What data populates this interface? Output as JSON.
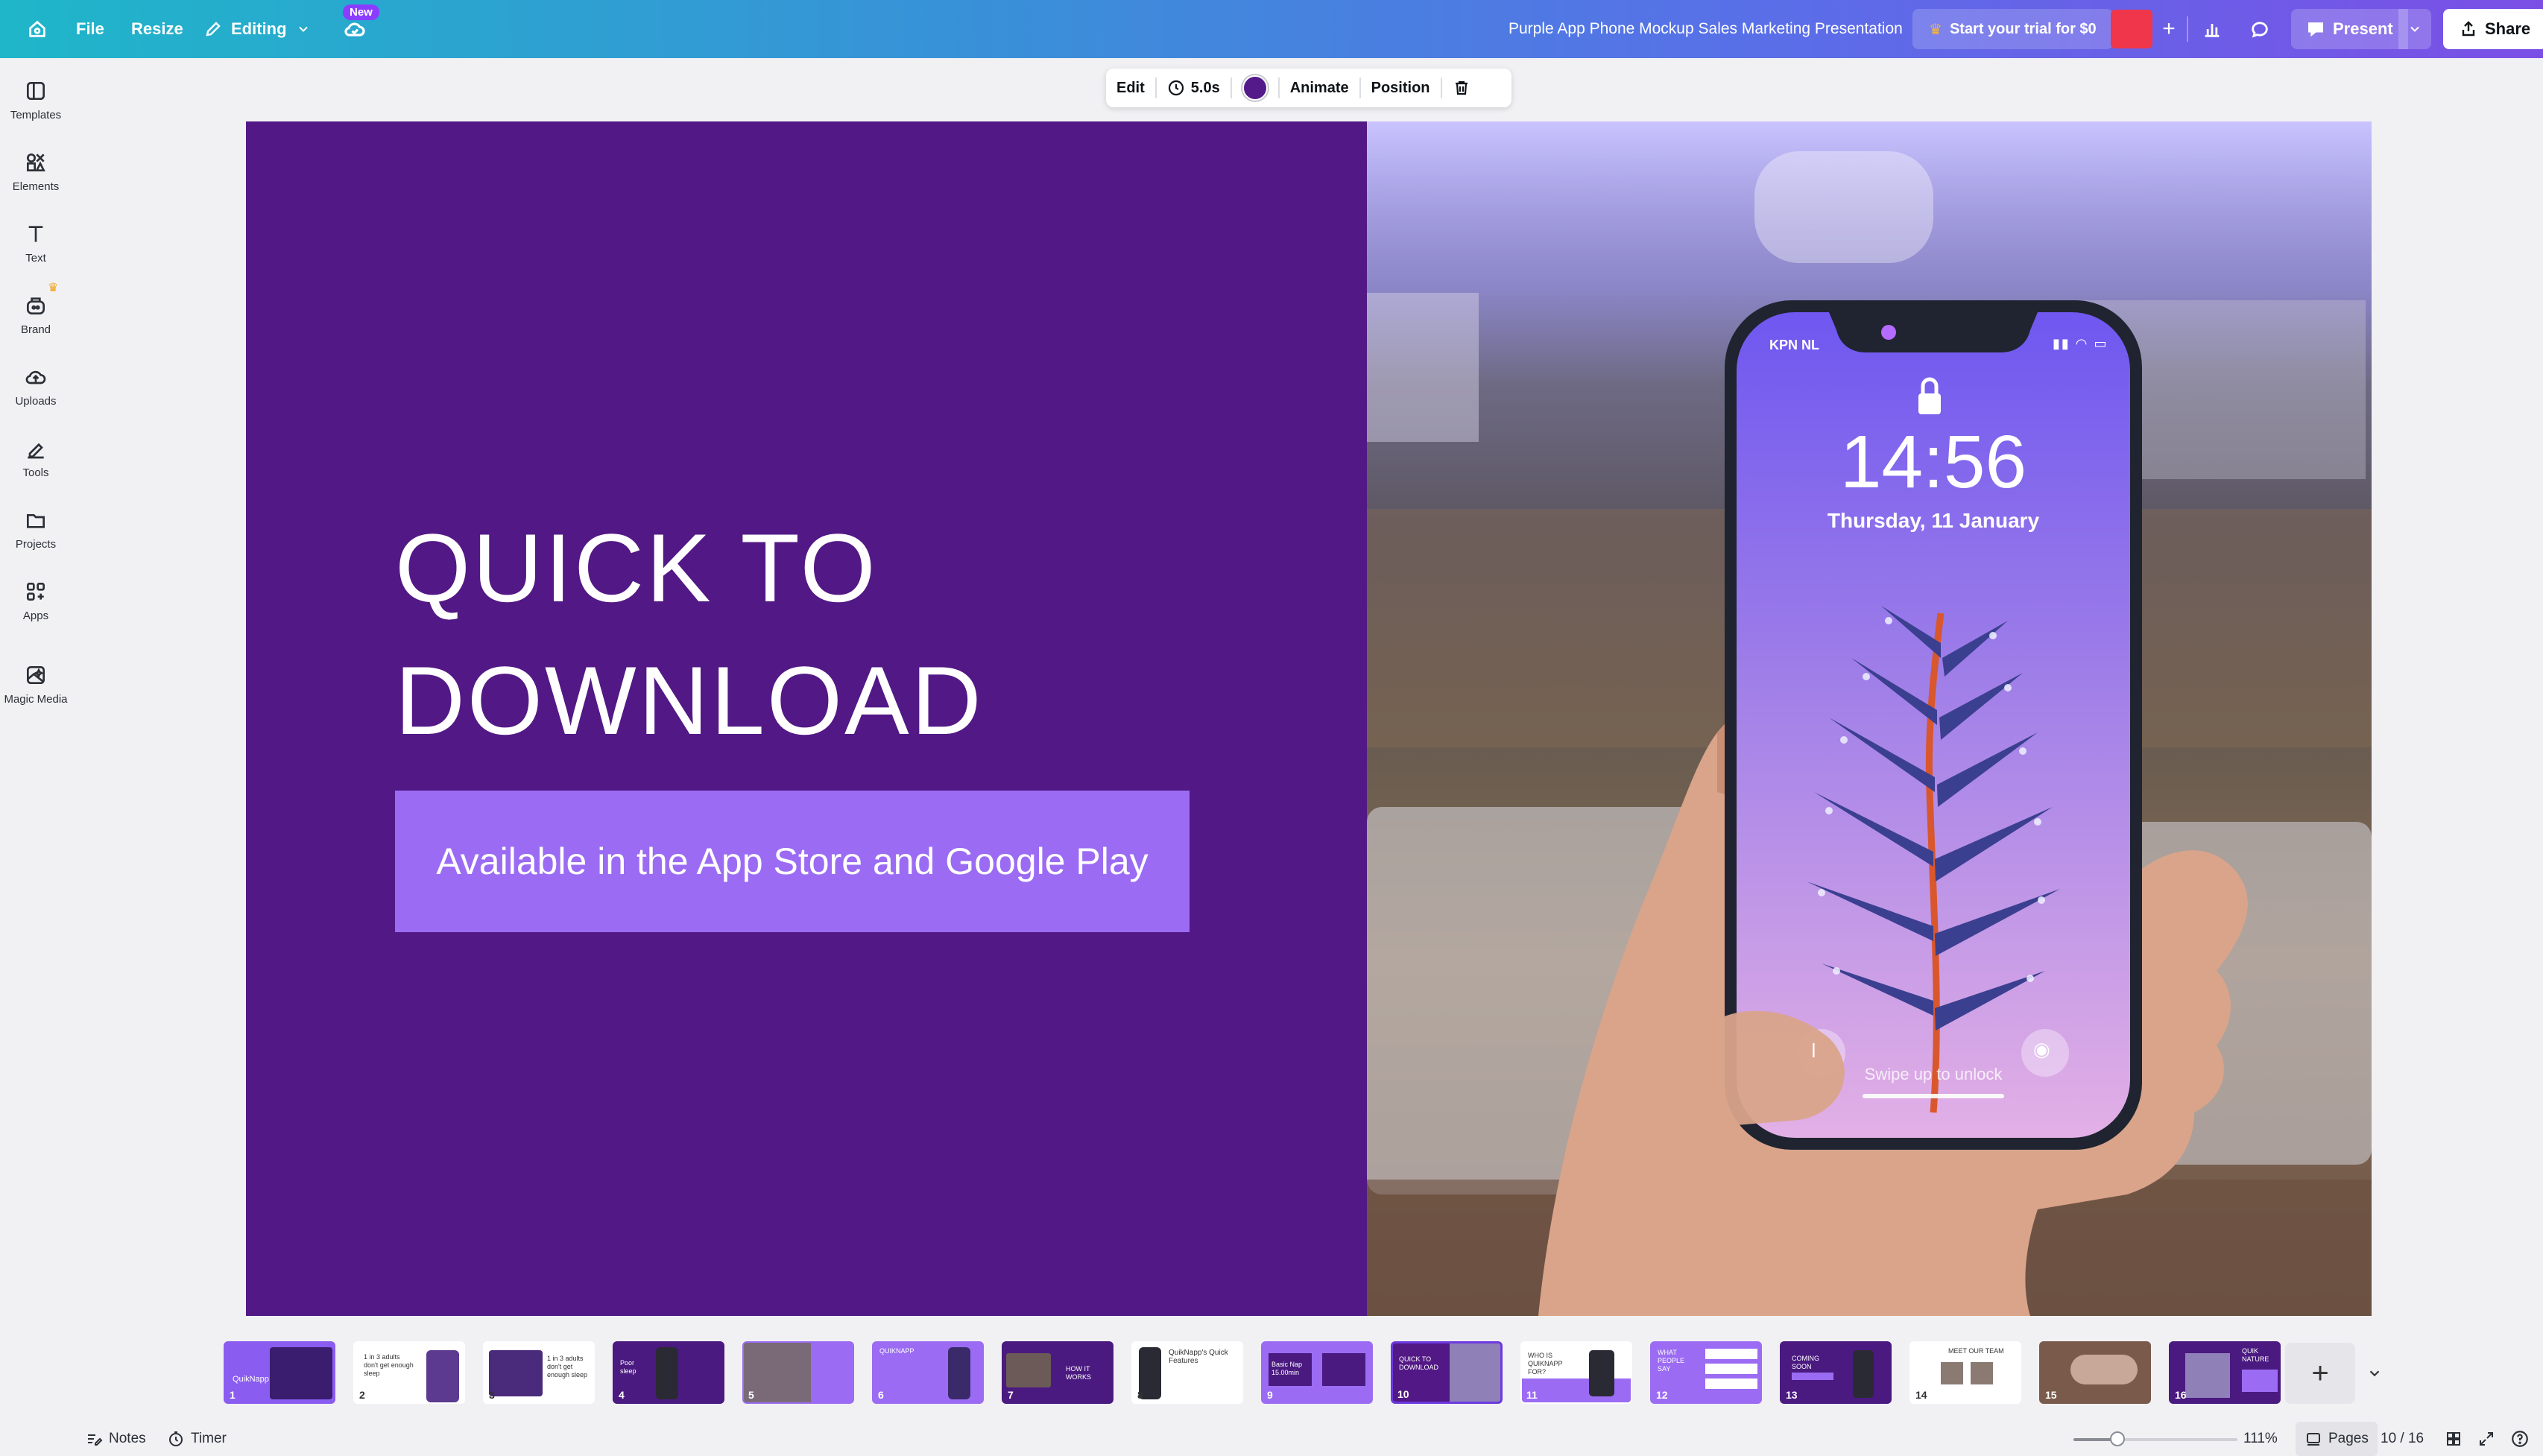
{
  "topbar": {
    "file_label": "File",
    "resize_label": "Resize",
    "editing_label": "Editing",
    "new_badge": "New",
    "doc_title": "Purple App Phone Mockup Sales Marketing Presentation",
    "trial_label": "Start your trial for $0",
    "present_label": "Present",
    "share_label": "Share",
    "brand_gradient": [
      "#1fb6c9",
      "#7b4fe6"
    ]
  },
  "sidebar": {
    "items": [
      {
        "label": "Templates",
        "icon": "templates-icon"
      },
      {
        "label": "Elements",
        "icon": "elements-icon"
      },
      {
        "label": "Text",
        "icon": "text-icon"
      },
      {
        "label": "Brand",
        "icon": "brand-icon"
      },
      {
        "label": "Uploads",
        "icon": "uploads-icon"
      },
      {
        "label": "Tools",
        "icon": "tools-icon"
      },
      {
        "label": "Projects",
        "icon": "projects-icon"
      },
      {
        "label": "Apps",
        "icon": "apps-icon"
      },
      {
        "label": "Magic Media",
        "icon": "magic-media-icon"
      }
    ]
  },
  "context_toolbar": {
    "edit_label": "Edit",
    "duration_label": "5.0s",
    "animate_label": "Animate",
    "position_label": "Position",
    "swatch_color": "#541a8a"
  },
  "slide": {
    "heading_line1": "QUICK TO",
    "heading_line2": "DOWNLOAD",
    "button_text": "Available in the App Store and Google Play",
    "background_color": "#521885",
    "button_color": "#9b6cf3",
    "phone": {
      "carrier": "KPN NL",
      "time": "14:56",
      "date": "Thursday, 11 January",
      "unlock_hint": "Swipe up to unlock"
    }
  },
  "filmstrip": {
    "pages": [
      {
        "num": "1",
        "caption": "QuikNapp"
      },
      {
        "num": "2",
        "caption": "1 in 3 adults don't get enough sleep"
      },
      {
        "num": "3",
        "caption": "1 in 3 adults don't get enough sleep"
      },
      {
        "num": "4",
        "caption": "Poor sleep"
      },
      {
        "num": "5",
        "caption": ""
      },
      {
        "num": "6",
        "caption": "QUIKNAPP"
      },
      {
        "num": "7",
        "caption": "HOW IT WORKS"
      },
      {
        "num": "8",
        "caption": "QuikNapp's Quick Features"
      },
      {
        "num": "9",
        "caption": "Basic Nap 15.00min"
      },
      {
        "num": "10",
        "caption": "QUICK TO DOWNLOAD"
      },
      {
        "num": "11",
        "caption": "WHO IS QUIKNAPP FOR?"
      },
      {
        "num": "12",
        "caption": "WHAT PEOPLE SAY"
      },
      {
        "num": "13",
        "caption": "COMING SOON"
      },
      {
        "num": "14",
        "caption": "MEET OUR TEAM"
      },
      {
        "num": "15",
        "caption": ""
      },
      {
        "num": "16",
        "caption": "QUIK NATURE"
      }
    ],
    "active_page": 10
  },
  "footer": {
    "notes_label": "Notes",
    "timer_label": "Timer",
    "zoom_label": "111%",
    "zoom_fraction": 0.27,
    "pages_label": "Pages",
    "page_counter": "10 / 16"
  }
}
